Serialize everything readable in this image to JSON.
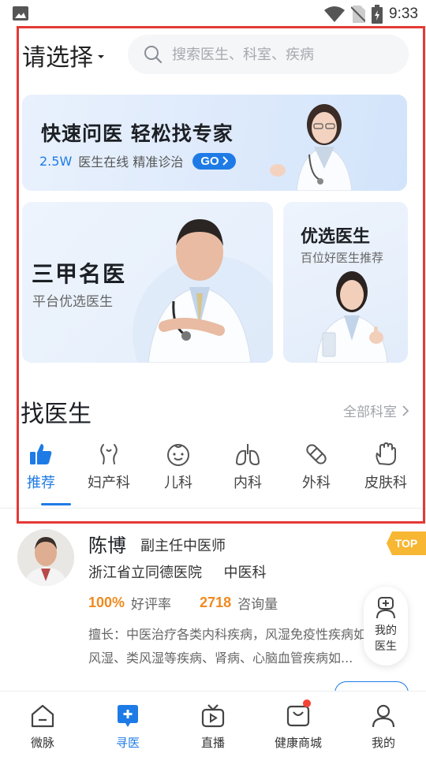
{
  "status_bar": {
    "time": "9:33"
  },
  "header": {
    "location_label": "请选择",
    "search_placeholder": "搜索医生、科室、疾病"
  },
  "banner": {
    "title": "快速问医 轻松找专家",
    "online_count": "2.5W",
    "subtitle": "医生在线 精准诊治",
    "go_label": "GO"
  },
  "cards": {
    "top_hospital": {
      "title": "三甲名医",
      "subtitle": "平台优选医生"
    },
    "featured": {
      "title": "优选医生",
      "subtitle": "百位好医生推荐"
    }
  },
  "find_doctor": {
    "title": "找医生",
    "all_departments_label": "全部科室",
    "tabs": [
      {
        "label": "推荐",
        "icon": "thumbs-up-icon",
        "active": true
      },
      {
        "label": "妇产科",
        "icon": "uterus-icon",
        "active": false
      },
      {
        "label": "儿科",
        "icon": "baby-face-icon",
        "active": false
      },
      {
        "label": "内科",
        "icon": "lungs-icon",
        "active": false
      },
      {
        "label": "外科",
        "icon": "bandage-icon",
        "active": false
      },
      {
        "label": "皮肤科",
        "icon": "hand-icon",
        "active": false
      }
    ]
  },
  "doctor_card": {
    "name": "陈博",
    "title": "副主任中医师",
    "badge": "TOP",
    "hospital": "浙江省立同德医院",
    "department": "中医科",
    "rating": "100%",
    "rating_label": "好评率",
    "consult_count": "2718",
    "consult_label": "咨询量",
    "expertise": "擅长：中医治疗各类内科疾病，风湿免疫性疾病如类风湿、类风湿等疾病、肾病、心脑血管疾病如..."
  },
  "float_button": {
    "label": "我的医生"
  },
  "bottom_nav": [
    {
      "label": "微脉",
      "icon": "home-icon",
      "active": false
    },
    {
      "label": "寻医",
      "icon": "medical-chat-icon",
      "active": true
    },
    {
      "label": "直播",
      "icon": "tv-play-icon",
      "active": false
    },
    {
      "label": "健康商城",
      "icon": "shopping-bag-icon",
      "active": false,
      "badge_dot": true
    },
    {
      "label": "我的",
      "icon": "user-icon",
      "active": false
    }
  ],
  "colors": {
    "accent": "#1e7be6",
    "orange": "#f08a1f",
    "highlight_frame": "#e53935",
    "top_badge": "#f7b733"
  }
}
